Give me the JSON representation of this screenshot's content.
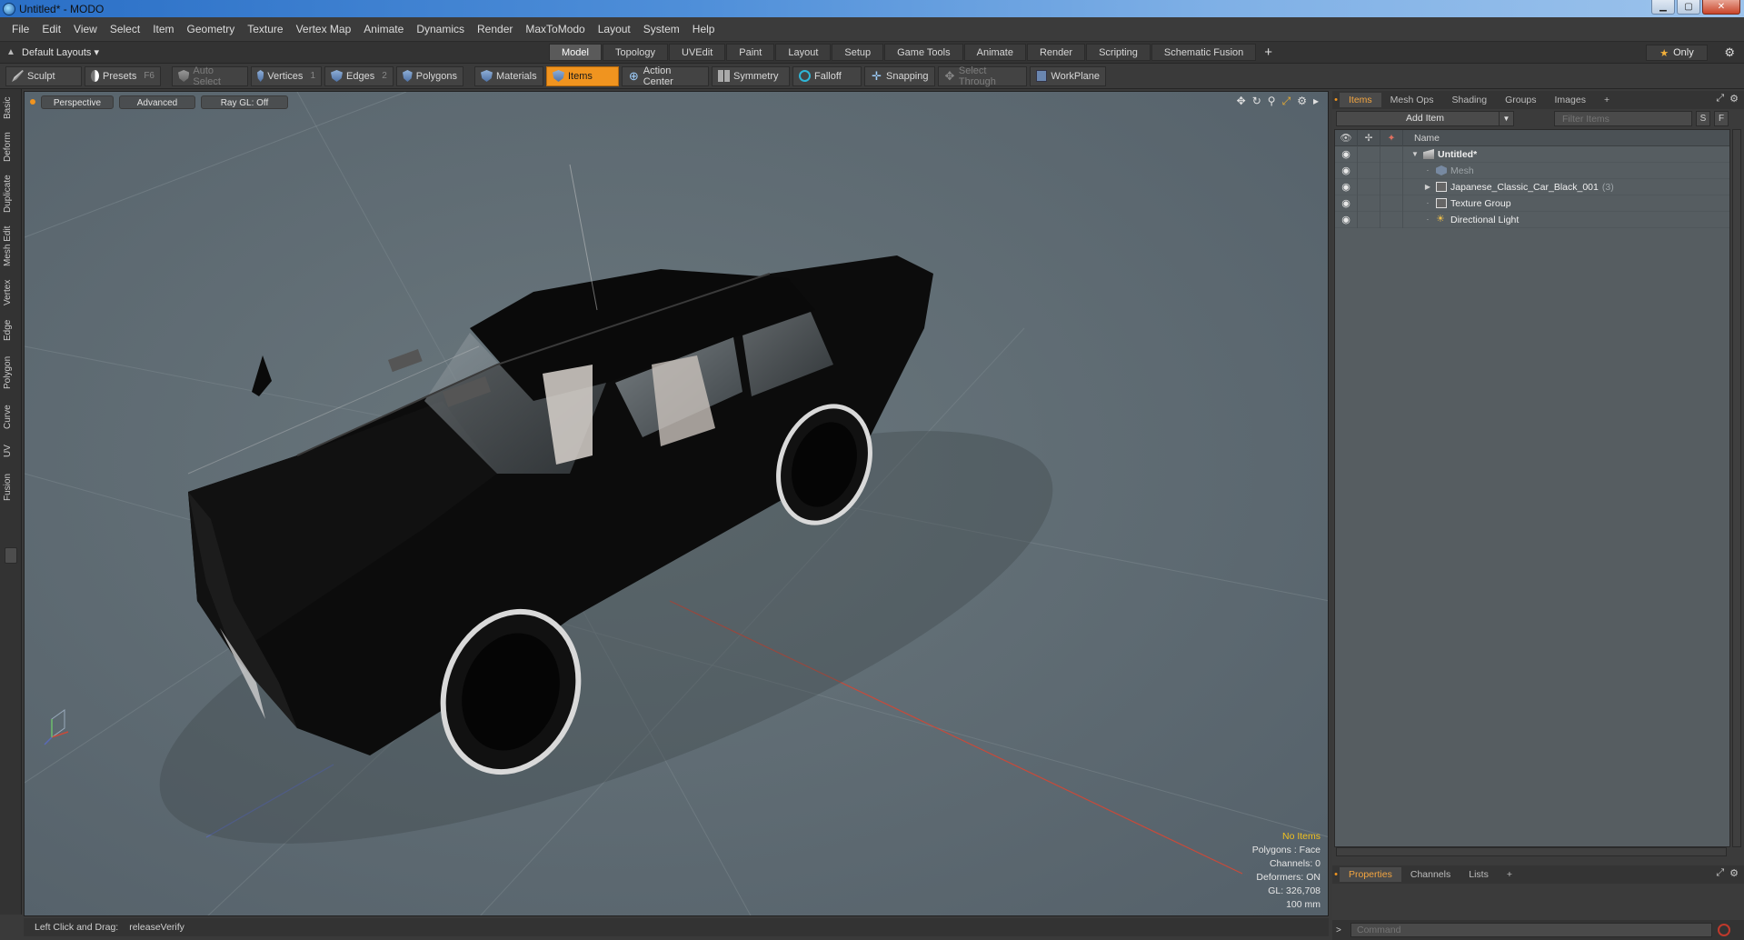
{
  "window": {
    "title": "Untitled* - MODO",
    "min": "▁",
    "max": "▢",
    "close": "✕"
  },
  "menu": [
    "File",
    "Edit",
    "View",
    "Select",
    "Item",
    "Geometry",
    "Texture",
    "Vertex Map",
    "Animate",
    "Dynamics",
    "Render",
    "MaxToModo",
    "Layout",
    "System",
    "Help"
  ],
  "layoutbar": {
    "layout": "Default Layouts ▾",
    "tabs": [
      "Model",
      "Topology",
      "UVEdit",
      "Paint",
      "Layout",
      "Setup",
      "Game Tools",
      "Animate",
      "Render",
      "Scripting",
      "Schematic Fusion"
    ],
    "active_tab": "Model",
    "only_label": "Only"
  },
  "toolbar": {
    "sculpt": "Sculpt",
    "presets": "Presets",
    "presets_key": "F6",
    "auto_select": "Auto Select",
    "vertices": "Vertices",
    "vertices_num": "1",
    "edges": "Edges",
    "edges_num": "2",
    "polygons": "Polygons",
    "materials": "Materials",
    "items": "Items",
    "action_center": "Action Center",
    "symmetry": "Symmetry",
    "falloff": "Falloff",
    "snapping": "Snapping",
    "select_through": "Select Through",
    "workplane": "WorkPlane"
  },
  "left_tabs": [
    "Basic",
    "Deform",
    "Duplicate",
    "Mesh Edit",
    "Vertex",
    "Edge",
    "Polygon",
    "Curve",
    "UV",
    "Fusion"
  ],
  "viewport": {
    "view": "Perspective",
    "advanced": "Advanced",
    "raygl": "Ray GL: Off",
    "info": {
      "no_items": "No Items",
      "polygons": "Polygons : Face",
      "channels": "Channels: 0",
      "deformers": "Deformers: ON",
      "gl": "GL: 326,708",
      "scale": "100 mm"
    }
  },
  "status": {
    "label": "Left Click and Drag:",
    "value": "releaseVerify"
  },
  "items_panel": {
    "tabs": [
      "Items",
      "Mesh Ops",
      "Shading",
      "Groups",
      "Images"
    ],
    "active_tab": "Items",
    "add_item": "Add Item",
    "filter_placeholder": "Filter Items",
    "s_btn": "S",
    "f_btn": "F",
    "name_header": "Name",
    "rows": [
      {
        "name": "Untitled*",
        "count": ""
      },
      {
        "name": "Mesh",
        "count": ""
      },
      {
        "name": "Japanese_Classic_Car_Black_001",
        "count": "(3)"
      },
      {
        "name": "Texture Group",
        "count": ""
      },
      {
        "name": "Directional Light",
        "count": ""
      }
    ]
  },
  "bottom_panel": {
    "tabs": [
      "Properties",
      "Channels",
      "Lists"
    ],
    "active_tab": "Properties",
    "command_placeholder": "Command"
  },
  "colors": {
    "accent": "#f0941f",
    "viewport_bg": "#5f6b70",
    "car_body": "#0c0c0c"
  }
}
